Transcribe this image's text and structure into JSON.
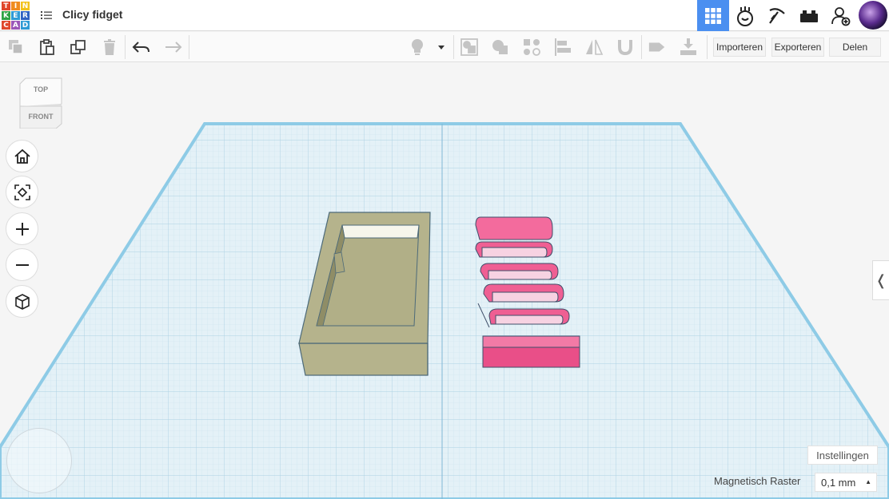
{
  "app": {
    "logo_letters": [
      "T",
      "I",
      "N",
      "K",
      "E",
      "R",
      "C",
      "A",
      "D"
    ],
    "logo_colors": [
      "#e0472c",
      "#f08b20",
      "#f2c21c",
      "#30a345",
      "#2e9bd5",
      "#3061c2",
      "#e0472c",
      "#9c56b8",
      "#2e9bd5"
    ],
    "title": "Clicy fidget"
  },
  "topbar": {
    "icons": [
      "grid-view-icon",
      "circuit-icon",
      "pickaxe-icon",
      "bricks-icon",
      "add-user-icon",
      "avatar"
    ],
    "accent": "#4b8ff0"
  },
  "toolbar": {
    "import_label": "Importeren",
    "export_label": "Exporteren",
    "share_label": "Delen"
  },
  "viewcube": {
    "top_label": "TOP",
    "front_label": "FRONT"
  },
  "canvas": {
    "settings_label": "Instellingen",
    "snap_label": "Magnetisch Raster",
    "snap_value": "0,1 mm",
    "collapse_glyph": "❬",
    "shape_colors": {
      "box": "#b5b38c",
      "spring": "#ef5f93"
    }
  }
}
